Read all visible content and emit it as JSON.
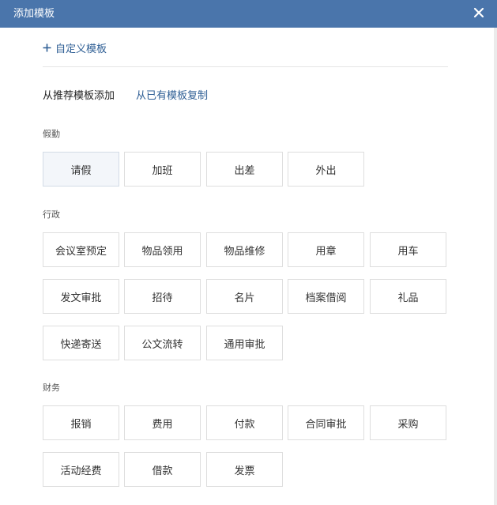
{
  "dialog": {
    "title": "添加模板"
  },
  "custom_template": {
    "label": "自定义模板"
  },
  "tabs": {
    "recommended": "从推荐模板添加",
    "copy_existing": "从已有模板复制"
  },
  "sections": {
    "leave": {
      "label": "假勤",
      "items": [
        "请假",
        "加班",
        "出差",
        "外出"
      ]
    },
    "admin": {
      "label": "行政",
      "items": [
        "会议室预定",
        "物品领用",
        "物品维修",
        "用章",
        "用车",
        "发文审批",
        "招待",
        "名片",
        "档案借阅",
        "礼品",
        "快递寄送",
        "公文流转",
        "通用审批"
      ]
    },
    "finance": {
      "label": "财务",
      "items": [
        "报销",
        "费用",
        "付款",
        "合同审批",
        "采购",
        "活动经费",
        "借款",
        "发票"
      ]
    }
  },
  "colors": {
    "titlebar": "#4a75ab",
    "link": "#2f5f95"
  },
  "icons": {
    "close": "close-icon",
    "add": "plus-icon"
  }
}
